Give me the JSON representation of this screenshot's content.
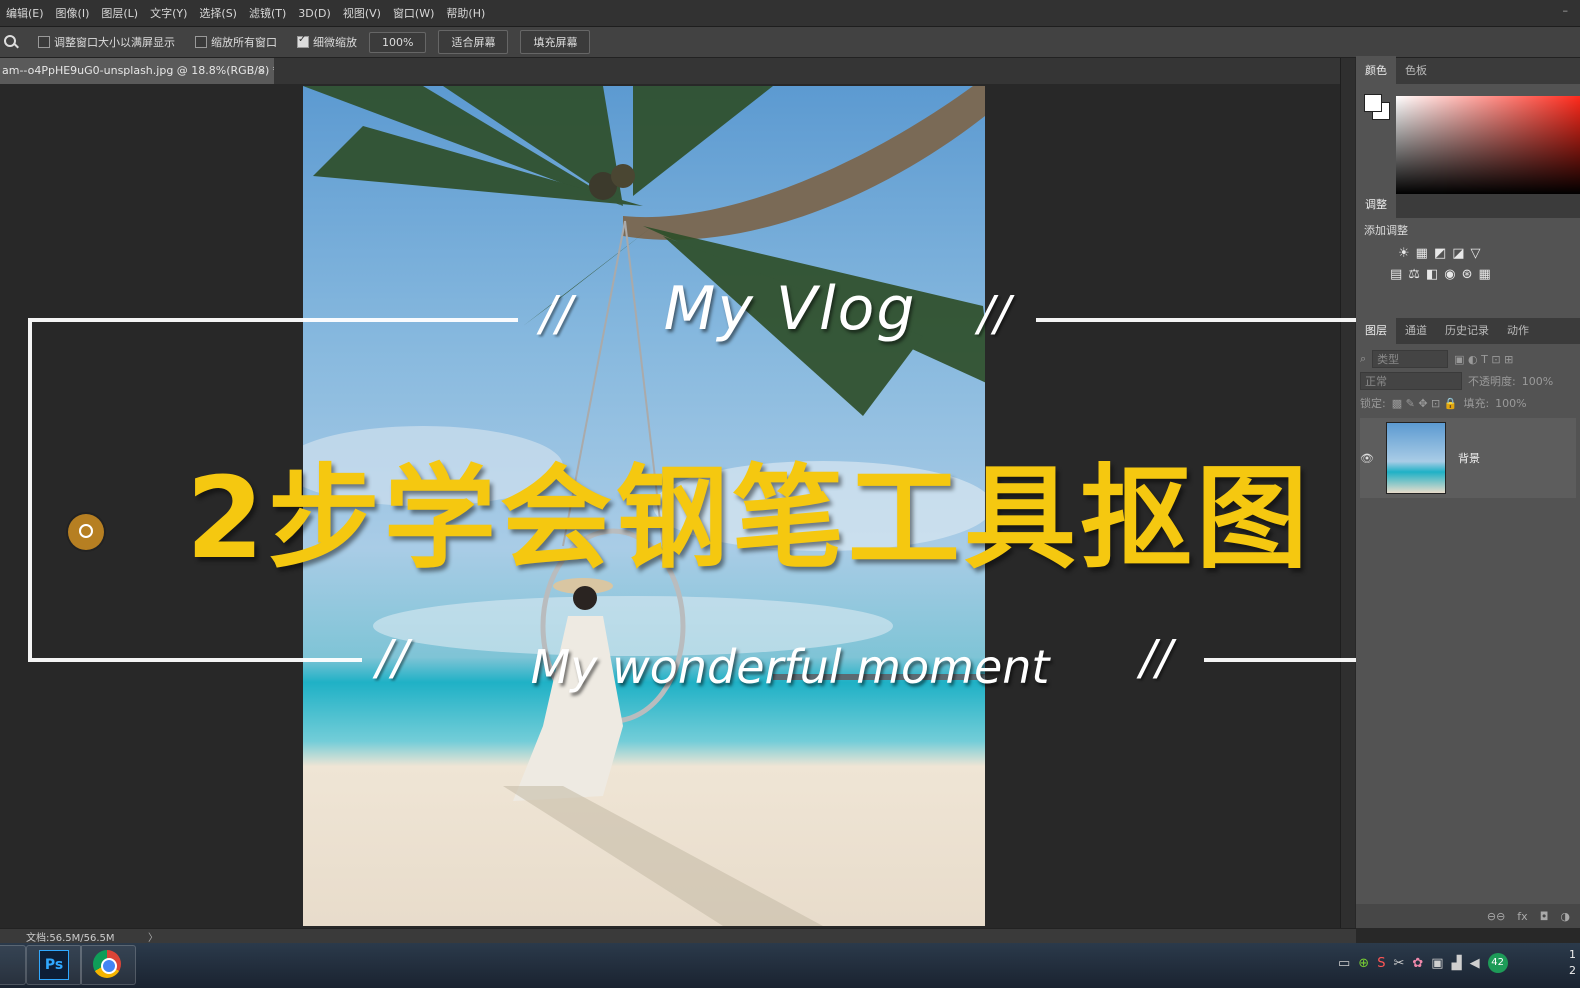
{
  "menu": [
    "编辑(E)",
    "图像(I)",
    "图层(L)",
    "文字(Y)",
    "选择(S)",
    "滤镜(T)",
    "3D(D)",
    "视图(V)",
    "窗口(W)",
    "帮助(H)"
  ],
  "options_bar": {
    "resize_window": "调整窗口大小以满屏显示",
    "zoom_all": "缩放所有窗口",
    "scrubby_zoom": "细微缩放",
    "btn_100": "100%",
    "btn_fit": "适合屏幕",
    "btn_fill": "填充屏幕"
  },
  "document_tab": {
    "title": "am--o4PpHE9uG0-unsplash.jpg @ 18.8%(RGB/8) *",
    "close": "×"
  },
  "overlay": {
    "title": "My Vlog",
    "headline": "2步学会钢笔工具抠图",
    "subtitle": "My wonderful moment",
    "slash": "//"
  },
  "color_panel": {
    "tabs": [
      "颜色",
      "色板"
    ]
  },
  "adjust_panel": {
    "tab": "调整",
    "label": "添加调整"
  },
  "layers_panel": {
    "tabs": [
      "图层",
      "通道",
      "历史记录",
      "动作"
    ],
    "search_placeholder": "类型",
    "blend_mode": "正常",
    "opacity_label": "不透明度:",
    "opacity_value": "100%",
    "lock_label": "锁定:",
    "fill_label": "填充:",
    "fill_value": "100%",
    "layer_name": "背景"
  },
  "status": {
    "doc": "文档:56.5M/56.5M",
    "arrow": "〉"
  },
  "taskbar": {
    "ps_label": "Ps",
    "badge": "42",
    "clock_line1": "1",
    "clock_line2": "2"
  },
  "colors": {
    "headline": "#f5c810",
    "panel": "#535353",
    "cursor": "#b67f22"
  }
}
